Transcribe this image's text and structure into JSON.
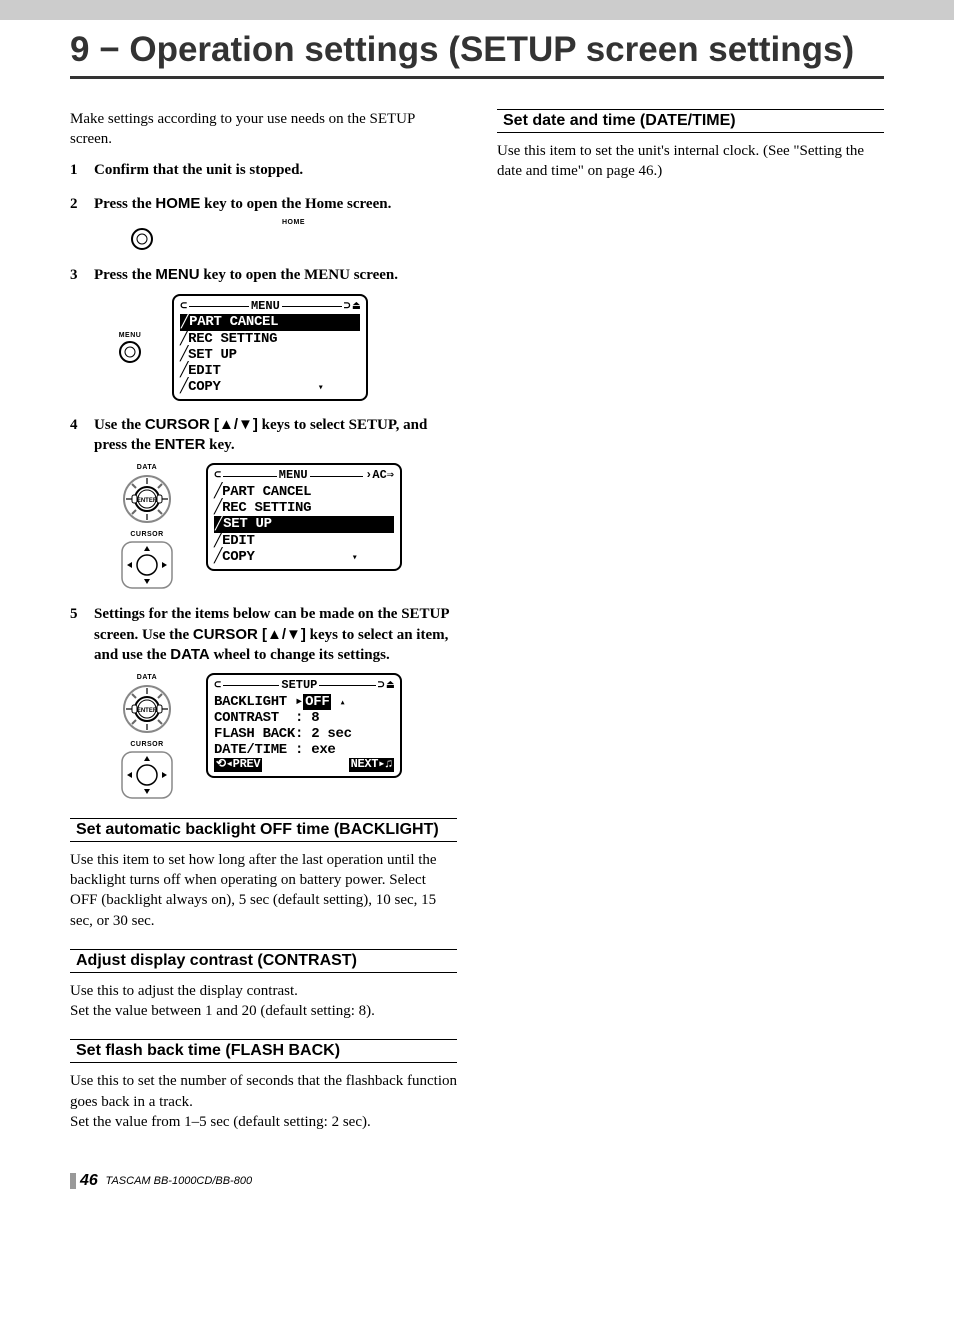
{
  "chapter_title": "9 − Operation settings (SETUP screen settings)",
  "intro": "Make settings according to your use needs on the SETUP screen.",
  "steps": {
    "s1": "Confirm that the unit is stopped.",
    "s2_a": "Press the ",
    "s2_key": "HOME",
    "s2_b": " key to open the Home screen.",
    "s3_a": "Press the ",
    "s3_key": "MENU",
    "s3_b": " key to open the MENU screen.",
    "s4_a": "Use the ",
    "s4_key1": "CURSOR [▲/▼]",
    "s4_b": " keys to select SETUP, and press the ",
    "s4_key2": "ENTER",
    "s4_c": " key.",
    "s5_a": "Settings for the items below can be made on the SETUP screen. Use the ",
    "s5_key1": "CURSOR [▲/▼]",
    "s5_b": " keys to select an item, and use the ",
    "s5_key2": "DATA",
    "s5_c": " wheel to change its settings."
  },
  "icons": {
    "home_label": "HOME",
    "menu_label": "MENU",
    "data_label": "DATA",
    "enter_label": "ENTER",
    "cursor_label": "CURSOR"
  },
  "lcd1": {
    "title": "MENU",
    "tr_right": "⏏",
    "rows": [
      "PART CANCEL",
      "REC SETTING",
      "SET UP",
      "EDIT",
      "COPY"
    ],
    "selected_index": 0
  },
  "lcd2": {
    "title": "MENU",
    "tr_right": "›AC⇒",
    "rows": [
      "PART CANCEL",
      "REC SETTING",
      "SET UP",
      "EDIT",
      "COPY"
    ],
    "selected_index": 2
  },
  "lcd3": {
    "title": "SETUP",
    "tr_right": "⏏",
    "rows_raw": [
      {
        "label": "BACKLIGHT ",
        "sep": "▸",
        "val": "OFF",
        "hl": true,
        "arrows": true
      },
      {
        "label": "CONTRAST  ",
        "sep": ": ",
        "val": "8"
      },
      {
        "label": "FLASH BACK",
        "sep": ": ",
        "val": "2 sec"
      },
      {
        "label": "DATE/TIME ",
        "sep": ": ",
        "val": "exe"
      }
    ],
    "footer_left": "⟲◂PREV",
    "footer_right": "NEXT▸♫"
  },
  "sections": {
    "backlight": {
      "heading": "Set automatic backlight OFF time (BACKLIGHT)",
      "body": "Use this item to set how long after the last operation until the backlight turns off when operating on battery power. Select OFF (backlight always on), 5 sec (default setting), 10 sec, 15 sec, or 30 sec."
    },
    "contrast": {
      "heading": "Adjust display contrast (CONTRAST)",
      "body1": "Use this to adjust the display contrast.",
      "body2": "Set the value between 1 and 20 (default setting: 8)."
    },
    "flashback": {
      "heading": "Set flash back time (FLASH BACK)",
      "body1": "Use this to set the number of seconds that the flashback function goes back in a track.",
      "body2": "Set the value from 1–5 sec (default setting: 2 sec)."
    },
    "datetime": {
      "heading": "Set date and time (DATE/TIME)",
      "body": "Use this item to set the unit's internal clock. (See \"Setting the date and time\" on page 46.)"
    }
  },
  "footer": {
    "page": "46",
    "model": "TASCAM  BB-1000CD/BB-800"
  }
}
